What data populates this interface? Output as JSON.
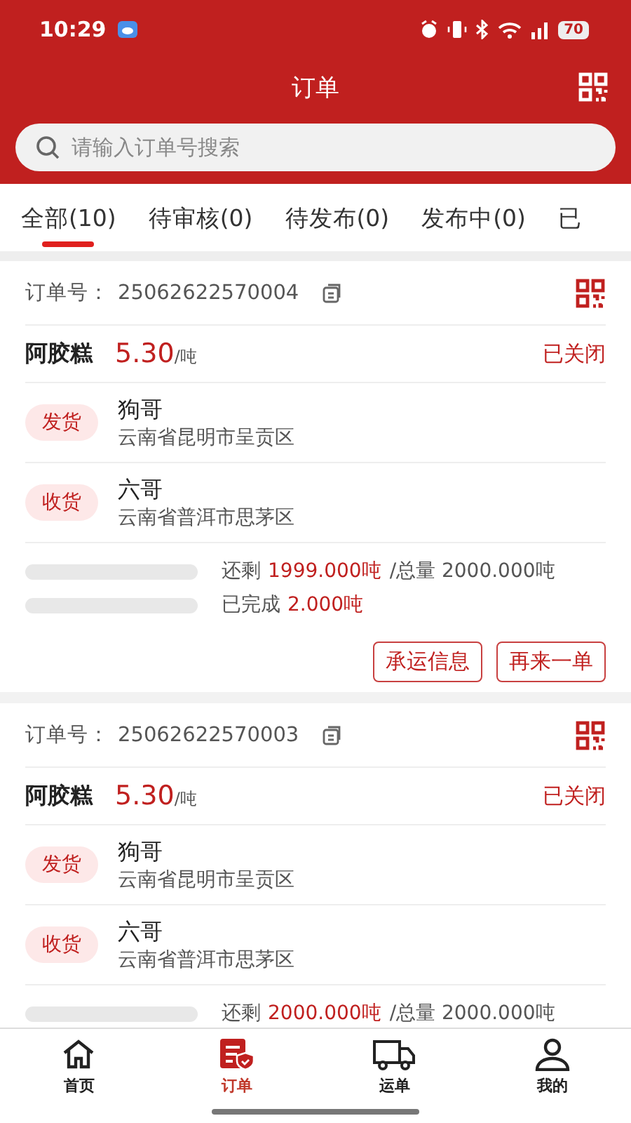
{
  "status_bar": {
    "time": "10:29",
    "battery": "70"
  },
  "header": {
    "title": "订单"
  },
  "search": {
    "placeholder": "请输入订单号搜索"
  },
  "tabs": [
    {
      "label": "全部(10)",
      "selected": true
    },
    {
      "label": "待审核(0)",
      "selected": false
    },
    {
      "label": "待发布(0)",
      "selected": false
    },
    {
      "label": "发布中(0)",
      "selected": false
    },
    {
      "label": "已",
      "selected": false
    }
  ],
  "orders": [
    {
      "order_no_label": "订单号：",
      "order_no": "25062622570004",
      "product": "阿胶糕",
      "price": "5.30",
      "unit": "/吨",
      "status": "已关闭",
      "parties": [
        {
          "tag": "发货",
          "name": "狗哥",
          "address": "云南省昆明市呈贡区"
        },
        {
          "tag": "收货",
          "name": "六哥",
          "address": "云南省普洱市思茅区"
        }
      ],
      "progress": [
        {
          "label": "还剩",
          "value": "1999.000吨",
          "extra": "/总量 2000.000吨",
          "level": 0
        },
        {
          "label": "已完成",
          "value": "2.000吨",
          "level": 0
        }
      ],
      "buttons": [
        "承运信息",
        "再来一单"
      ]
    },
    {
      "order_no_label": "订单号：",
      "order_no": "25062622570003",
      "product": "阿胶糕",
      "price": "5.30",
      "unit": "/吨",
      "status": "已关闭",
      "parties": [
        {
          "tag": "发货",
          "name": "狗哥",
          "address": "云南省昆明市呈贡区"
        },
        {
          "tag": "收货",
          "name": "六哥",
          "address": "云南省普洱市思茅区"
        }
      ],
      "progress": [
        {
          "label": "还剩",
          "value": "2000.000吨",
          "extra": "/总量 2000.000吨",
          "level": 0
        }
      ]
    }
  ],
  "nav": [
    {
      "label": "首页",
      "selected": false
    },
    {
      "label": "订单",
      "selected": true
    },
    {
      "label": "运单",
      "selected": false
    },
    {
      "label": "我的",
      "selected": false
    }
  ]
}
